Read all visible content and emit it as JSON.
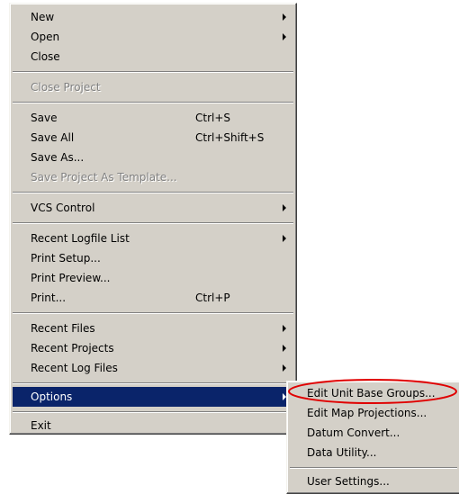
{
  "file_menu": {
    "new": {
      "label": "New"
    },
    "open": {
      "label": "Open"
    },
    "close": {
      "label": "Close"
    },
    "close_project": {
      "label": "Close Project"
    },
    "save": {
      "label": "Save",
      "shortcut": "Ctrl+S"
    },
    "save_all": {
      "label": "Save All",
      "shortcut": "Ctrl+Shift+S"
    },
    "save_as": {
      "label": "Save As..."
    },
    "save_project_as_template": {
      "label": "Save Project As Template..."
    },
    "vcs_control": {
      "label": "VCS Control"
    },
    "recent_logfile_list": {
      "label": "Recent Logfile List"
    },
    "print_setup": {
      "label": "Print Setup..."
    },
    "print_preview": {
      "label": "Print Preview..."
    },
    "print": {
      "label": "Print...",
      "shortcut": "Ctrl+P"
    },
    "recent_files": {
      "label": "Recent Files"
    },
    "recent_projects": {
      "label": "Recent Projects"
    },
    "recent_log_files": {
      "label": "Recent Log Files"
    },
    "options": {
      "label": "Options"
    },
    "exit": {
      "label": "Exit"
    }
  },
  "options_submenu": {
    "edit_unit_base_groups": {
      "label": "Edit Unit Base Groups..."
    },
    "edit_map_projections": {
      "label": "Edit Map Projections..."
    },
    "datum_convert": {
      "label": "Datum Convert..."
    },
    "data_utility": {
      "label": "Data Utility..."
    },
    "user_settings": {
      "label": "User Settings..."
    }
  },
  "colors": {
    "menu_background": "#d4d0c8",
    "highlight": "#0a246a",
    "annotation": "#e00000"
  }
}
